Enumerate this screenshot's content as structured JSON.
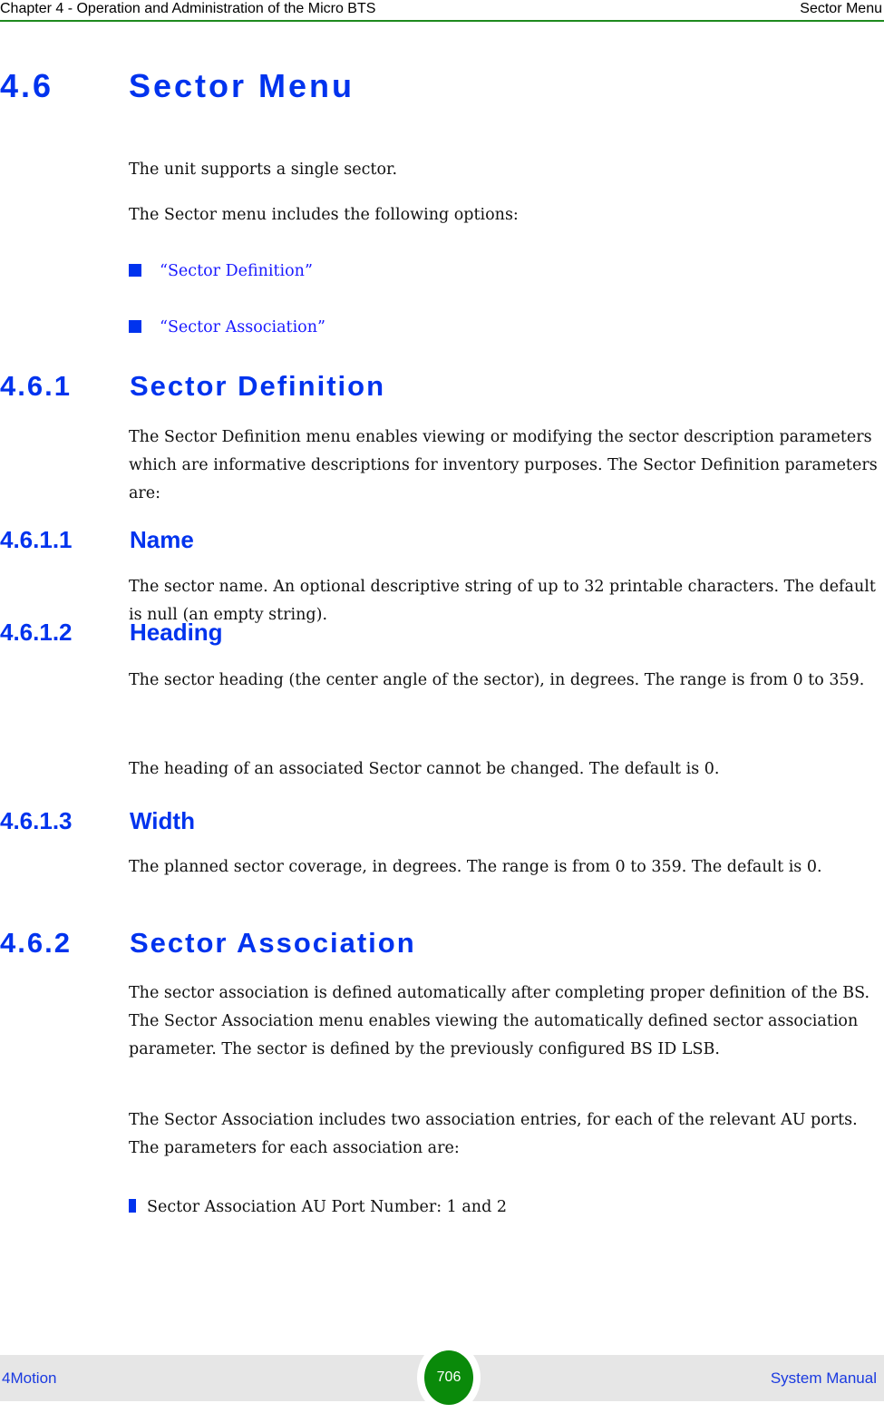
{
  "header": {
    "chapter": "Chapter 4 - Operation and Administration of the Micro BTS",
    "section": "Sector Menu"
  },
  "section": {
    "number": "4.6",
    "title": "Sector Menu",
    "paragraphs": [
      "The unit supports a single sector.",
      "The Sector menu includes the following options:"
    ],
    "links": [
      "“Sector Definition”",
      "“Sector Association”"
    ]
  },
  "sector_definition": {
    "number": "4.6.1",
    "title": "Sector Definition",
    "intro": "The Sector Definition menu enables viewing or modifying the sector description parameters which are informative descriptions for inventory purposes. The Sector Definition parameters are:",
    "params": [
      {
        "number": "4.6.1.1",
        "title": "Name",
        "paragraphs": [
          "The sector name. An optional descriptive string of up to 32 printable characters. The default is null (an empty string)."
        ]
      },
      {
        "number": "4.6.1.2",
        "title": "Heading",
        "paragraphs": [
          "The sector heading (the center angle of the sector), in degrees. The range is from 0 to 359.",
          "The heading of an associated Sector cannot be changed. The default is 0."
        ]
      },
      {
        "number": "4.6.1.3",
        "title": "Width",
        "paragraphs": [
          "The planned sector coverage, in degrees. The range is from 0 to 359. The default is 0."
        ]
      }
    ]
  },
  "sector_association": {
    "number": "4.6.2",
    "title": "Sector Association",
    "paragraphs": [
      "The sector association is defined automatically after completing proper definition of the BS. The Sector Association menu enables viewing the automatically defined sector association parameter. The sector is defined by the previously configured BS ID LSB.",
      "The Sector Association includes two association entries, for each of the relevant AU ports. The parameters for each association are:"
    ],
    "bullets": [
      "Sector Association AU Port Number: 1 and 2"
    ]
  },
  "footer": {
    "product": "4Motion",
    "page_number": "706",
    "manual": "System Manual"
  },
  "colors": {
    "heading_blue": "#0033ee",
    "link_blue": "#1a1aff",
    "rule_green": "#1e8a1e",
    "page_badge_green": "#0a8a0a",
    "footer_bg": "#e6e6e6"
  }
}
